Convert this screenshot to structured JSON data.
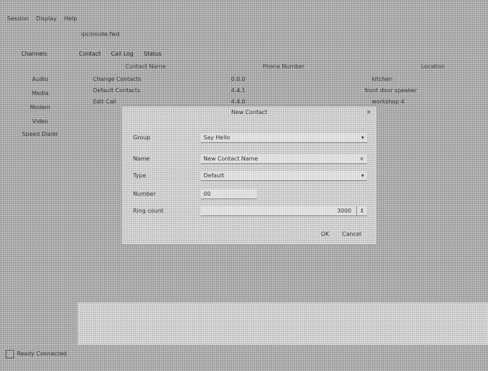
{
  "menubar": {
    "items": [
      "Session",
      "Display",
      "Help"
    ]
  },
  "path": "ipconsole.fwd",
  "sidebar": {
    "tab_label": "Channels",
    "items": [
      "Audio",
      "Media",
      "Modem",
      "Video",
      "Speed Dialer"
    ]
  },
  "tabs": [
    "Contact",
    "Call Log",
    "Status"
  ],
  "table": {
    "headers": [
      "Contact Name",
      "Phone Number",
      "Location"
    ],
    "rows": [
      [
        "Change Contacts",
        "0.0.0",
        "kitchen"
      ],
      [
        "Default Contacts",
        "4.4.1",
        "front door speaker"
      ],
      [
        "Edit Call",
        "4.4.0",
        "workshop 4"
      ]
    ]
  },
  "dialog": {
    "title": "New Contact",
    "close_icon": "close-icon",
    "fields": [
      {
        "label": "Group",
        "value": "Say Hello"
      },
      {
        "label": "Name",
        "value": "New Contact Name"
      },
      {
        "label": "Type",
        "value": "Default"
      },
      {
        "label": "Number",
        "value": "00"
      },
      {
        "label": "Ring count",
        "value": "3000"
      }
    ],
    "ok_label": "OK",
    "cancel_label": "Cancel"
  },
  "bottom_panel_text": "",
  "status": {
    "text": "Ready  Connected"
  }
}
